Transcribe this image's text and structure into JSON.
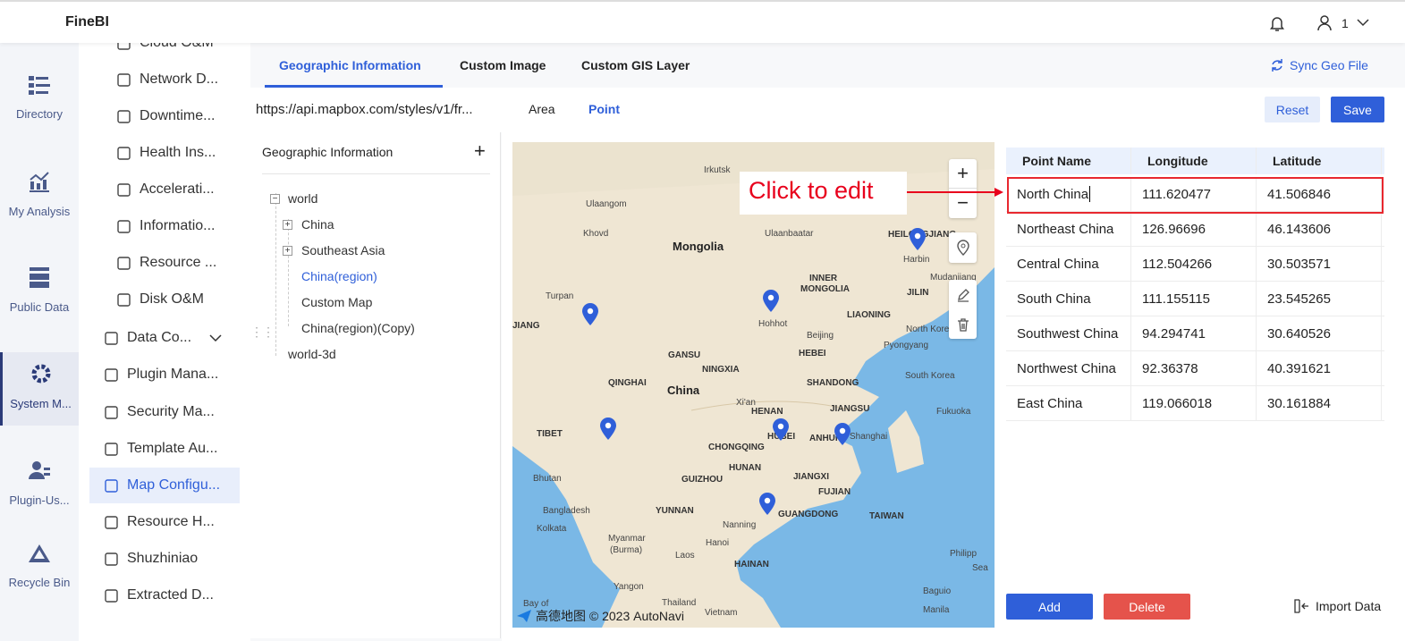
{
  "app": {
    "title": "FineBI",
    "user": "1"
  },
  "icon_nav": [
    {
      "label": "Directory"
    },
    {
      "label": "My Analysis"
    },
    {
      "label": "Public Data"
    },
    {
      "label": "System M..."
    },
    {
      "label": "Plugin-Us..."
    },
    {
      "label": "Recycle Bin"
    }
  ],
  "menu": [
    {
      "label": "Cloud O&M"
    },
    {
      "label": "Network D..."
    },
    {
      "label": "Downtime..."
    },
    {
      "label": "Health Ins..."
    },
    {
      "label": "Accelerati..."
    },
    {
      "label": "Informatio..."
    },
    {
      "label": "Resource ..."
    },
    {
      "label": "Disk O&M"
    },
    {
      "label": "Data Co..."
    },
    {
      "label": "Plugin Mana..."
    },
    {
      "label": "Security Ma..."
    },
    {
      "label": "Template Au..."
    },
    {
      "label": "Map Configu..."
    },
    {
      "label": "Resource H..."
    },
    {
      "label": "Shuzhiniao"
    },
    {
      "label": "Extracted D..."
    }
  ],
  "tabs": [
    {
      "label": "Geographic Information"
    },
    {
      "label": "Custom Image"
    },
    {
      "label": "Custom GIS Layer"
    }
  ],
  "sync_label": "Sync Geo File",
  "url": "https://api.mapbox.com/styles/v1/fr...",
  "subtabs": [
    {
      "label": "Area"
    },
    {
      "label": "Point"
    }
  ],
  "reset_label": "Reset",
  "save_label": "Save",
  "tree": {
    "title": "Geographic Information",
    "nodes": [
      {
        "label": "world"
      },
      {
        "label": "China"
      },
      {
        "label": "Southeast Asia"
      },
      {
        "label": "China(region)"
      },
      {
        "label": "Custom Map"
      },
      {
        "label": "China(region)(Copy)"
      },
      {
        "label": "world-3d"
      }
    ]
  },
  "map": {
    "labels": [
      "Irkutsk",
      "Ulaangom",
      "Ulaanbaatar",
      "Khovd",
      "Mongolia",
      "HEILONGJIANG",
      "Harbin",
      "Mudanjiang",
      "INNER",
      "MONGOLIA",
      "JILIN",
      "Turpan",
      "Hohhot",
      "LIAONING",
      "JIANG",
      "Beijing",
      "North Korea",
      "Pyongyang",
      "GANSU",
      "NINGXIA",
      "HEBEI",
      "QINGHAI",
      "China",
      "SHANDONG",
      "South Korea",
      "Xi'an",
      "HENAN",
      "JIANGSU",
      "Fukuoka",
      "TIBET",
      "HUBEI",
      "ANHUI",
      "Shanghai",
      "CHONGQING",
      "HUNAN",
      "JIANGXI",
      "Bhutan",
      "GUIZHOU",
      "FUJIAN",
      "Bangladesh",
      "YUNNAN",
      "GUANGDONG",
      "TAIWAN",
      "Nanning",
      "Kolkata",
      "Myanmar",
      "(Burma)",
      "Hanoi",
      "Laos",
      "HAINAN",
      "Philipp",
      "Sea",
      "Yangon",
      "Baguio",
      "Thailand",
      "Vietnam",
      "Manila",
      "Bay of"
    ],
    "attribution": "高德地图 © 2023 AutoNavi",
    "annotation": "Click to edit"
  },
  "table": {
    "headers": [
      "Point Name",
      "Longitude",
      "Latitude"
    ],
    "rows": [
      [
        "North China",
        "111.620477",
        "41.506846"
      ],
      [
        "Northeast China",
        "126.96696",
        "46.143606"
      ],
      [
        "Central China",
        "112.504266",
        "30.503571"
      ],
      [
        "South China",
        "111.155115",
        "23.545265"
      ],
      [
        "Southwest China",
        "94.294741",
        "30.640526"
      ],
      [
        "Northwest China",
        "92.36378",
        "40.391621"
      ],
      [
        "East China",
        "119.066018",
        "30.161884"
      ]
    ]
  },
  "add_label": "Add",
  "delete_label": "Delete",
  "import_label": "Import Data"
}
